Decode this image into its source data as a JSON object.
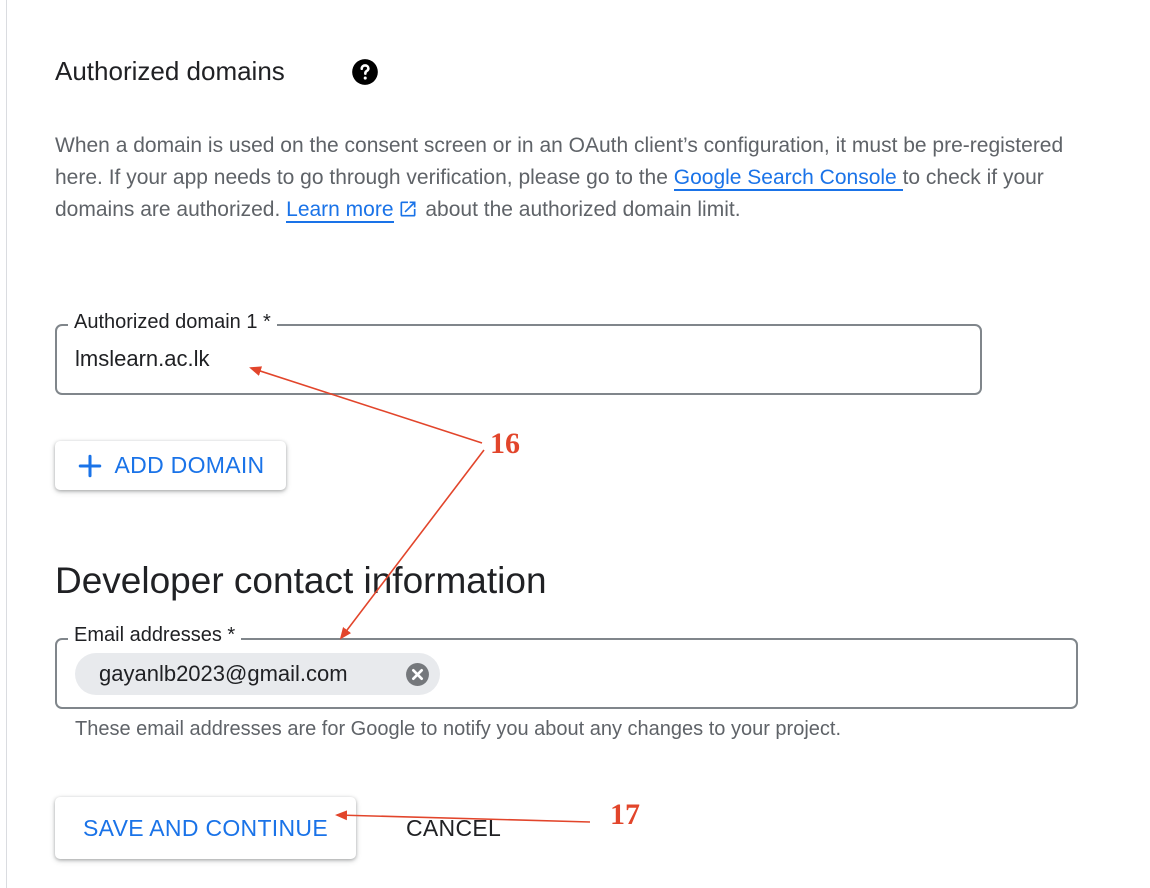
{
  "authorized_domains": {
    "title": "Authorized domains",
    "help_icon": "help-circle-icon",
    "description_1": "When a domain is used on the consent screen or in an OAuth client’s configuration, it must be pre-registered here. If your app needs to go through verification, please go to the ",
    "search_console_link": "Google Search Console ",
    "description_2": "to check if your domains are authorized. ",
    "learn_more_link": "Learn more",
    "external_link_icon": "open-in-new-icon",
    "description_3": " about the authorized domain limit.",
    "field_label": "Authorized domain 1 *",
    "field_value": "lmslearn.ac.lk",
    "add_button_label": "ADD DOMAIN",
    "add_button_icon": "plus-icon"
  },
  "developer_contact": {
    "title": "Developer contact information",
    "field_label": "Email addresses *",
    "email_chip": "gayanlb2023@gmail.com",
    "chip_remove_icon": "cancel-circle-icon",
    "helper_text": "These email addresses are for Google to notify you about any changes to your project."
  },
  "actions": {
    "save_label": "SAVE AND CONTINUE",
    "cancel_label": "CANCEL"
  },
  "annotations": {
    "step_16": "16",
    "step_17": "17",
    "color": "#e2452b"
  },
  "colors": {
    "accent": "#1a73e8",
    "text": "#202124",
    "secondary_text": "#5f6368",
    "outline": "#80868b",
    "chip_bg": "#e8eaed"
  }
}
